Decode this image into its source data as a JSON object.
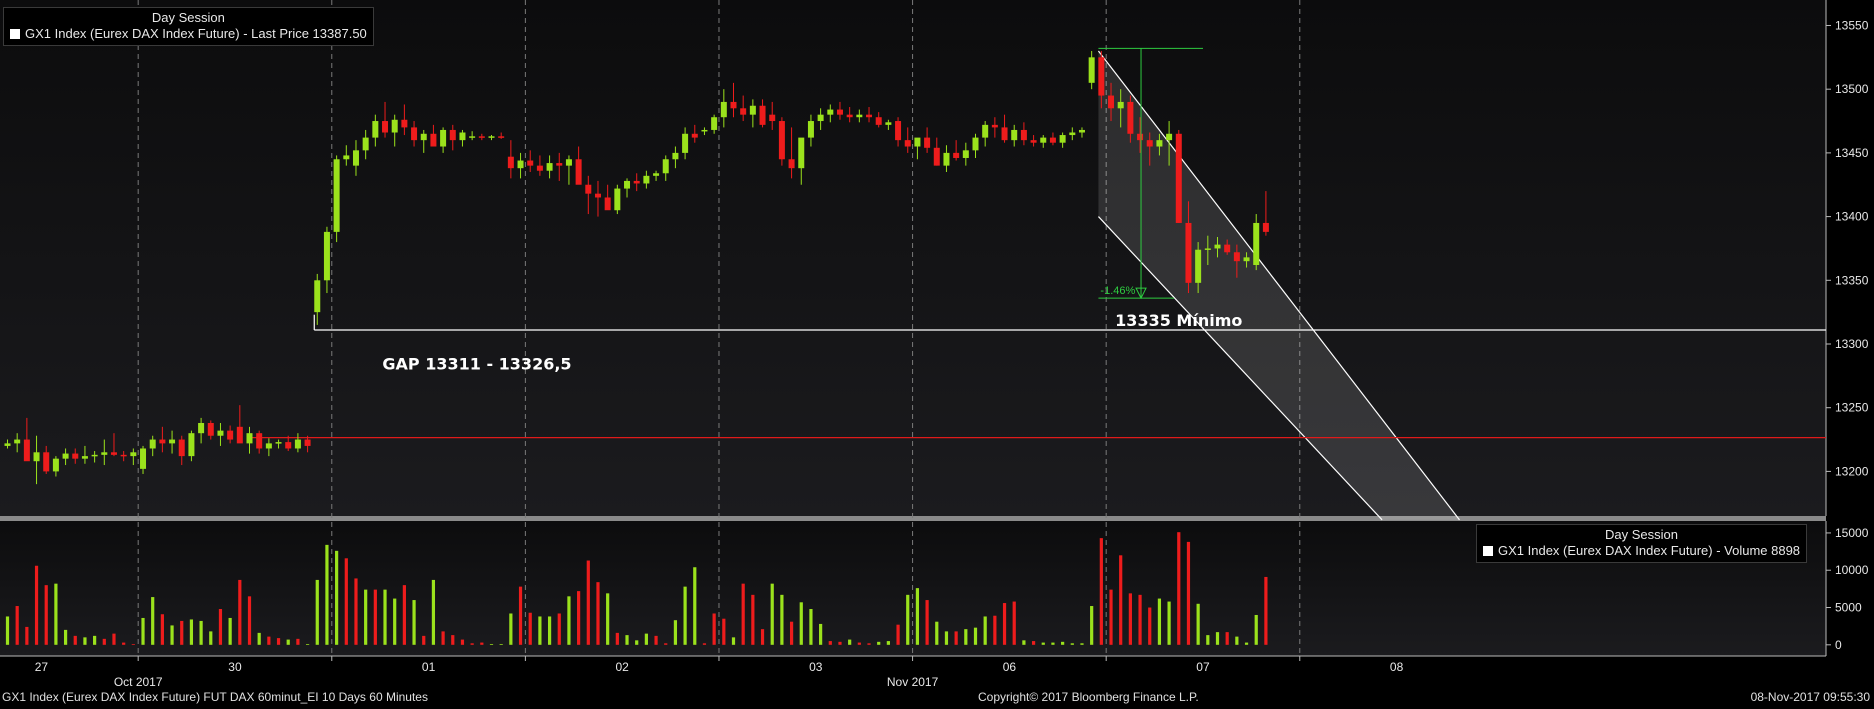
{
  "legend_price": {
    "session": "Day Session",
    "series": "GX1 Index (Eurex DAX Index Future) - Last Price 13387.50"
  },
  "legend_volume": {
    "session": "Day Session",
    "series": "GX1 Index (Eurex DAX Index Future) - Volume 8898"
  },
  "footer": {
    "left": "GX1 Index (Eurex DAX Index Future) FUT DAX 60minut_EI 10 Days 60 Minutes",
    "center": "Copyright© 2017 Bloomberg Finance L.P.",
    "right": "08-Nov-2017 09:55:30"
  },
  "colors": {
    "up": "#9be21c",
    "down": "#ee1c1c",
    "grid": "#7a7a7a",
    "line": "#ffffff"
  },
  "chart_data": {
    "type": "candlestick",
    "price_axis": {
      "ticks": [
        13200,
        13250,
        13300,
        13350,
        13400,
        13450,
        13500,
        13550
      ],
      "range": [
        13165,
        13570
      ]
    },
    "volume_axis": {
      "ticks": [
        0,
        5000,
        10000,
        15000
      ],
      "range": [
        -1500,
        16600
      ]
    },
    "x_tick_labels": [
      {
        "label": "27",
        "slot": 3.5
      },
      {
        "label": "30",
        "slot": 23.5
      },
      {
        "label": "01",
        "slot": 43.5
      },
      {
        "label": "02",
        "slot": 63.5
      },
      {
        "label": "03",
        "slot": 83.5
      },
      {
        "label": "06",
        "slot": 103.5
      },
      {
        "label": "07",
        "slot": 123.5
      },
      {
        "label": "08",
        "slot": 143.5
      }
    ],
    "month_labels": [
      {
        "label": "Oct 2017",
        "slot": 13.5
      },
      {
        "label": "Nov 2017",
        "slot": 93.5
      }
    ],
    "session_breaks": [
      13.5,
      33.5,
      53.5,
      73.5,
      93.5,
      113.5,
      133.5
    ],
    "candles": [
      [
        13220,
        13225,
        13218,
        13222
      ],
      [
        13222,
        13230,
        13215,
        13225
      ],
      [
        13225,
        13242,
        13210,
        13208
      ],
      [
        13208,
        13228,
        13190,
        13215
      ],
      [
        13215,
        13220,
        13198,
        13200
      ],
      [
        13200,
        13212,
        13196,
        13210
      ],
      [
        13210,
        13218,
        13205,
        13214
      ],
      [
        13214,
        13218,
        13206,
        13210
      ],
      [
        13210,
        13220,
        13206,
        13212
      ],
      [
        13212,
        13216,
        13207,
        13213
      ],
      [
        13213,
        13225,
        13205,
        13215
      ],
      [
        13215,
        13230,
        13212,
        13213
      ],
      [
        13213,
        13216,
        13208,
        13212
      ],
      [
        13212,
        13218,
        13205,
        13215
      ],
      [
        13202,
        13220,
        13198,
        13218
      ],
      [
        13218,
        13228,
        13212,
        13225
      ],
      [
        13225,
        13235,
        13215,
        13222
      ],
      [
        13222,
        13232,
        13214,
        13225
      ],
      [
        13225,
        13228,
        13205,
        13212
      ],
      [
        13212,
        13232,
        13208,
        13230
      ],
      [
        13230,
        13242,
        13222,
        13238
      ],
      [
        13238,
        13240,
        13225,
        13228
      ],
      [
        13228,
        13238,
        13220,
        13232
      ],
      [
        13232,
        13236,
        13222,
        13225
      ],
      [
        13235,
        13252,
        13225,
        13222
      ],
      [
        13222,
        13235,
        13214,
        13230
      ],
      [
        13230,
        13232,
        13214,
        13218
      ],
      [
        13218,
        13226,
        13212,
        13222
      ],
      [
        13222,
        13225,
        13218,
        13223
      ],
      [
        13223,
        13228,
        13216,
        13218
      ],
      [
        13218,
        13230,
        13215,
        13225
      ],
      [
        13225,
        13228,
        13215,
        13220
      ],
      [
        13325,
        13355,
        13315,
        13350
      ],
      [
        13350,
        13392,
        13340,
        13388
      ],
      [
        13388,
        13448,
        13380,
        13445
      ],
      [
        13445,
        13456,
        13440,
        13448
      ],
      [
        13440,
        13460,
        13432,
        13452
      ],
      [
        13452,
        13468,
        13445,
        13462
      ],
      [
        13462,
        13480,
        13455,
        13475
      ],
      [
        13475,
        13490,
        13462,
        13466
      ],
      [
        13466,
        13480,
        13455,
        13476
      ],
      [
        13476,
        13488,
        13464,
        13470
      ],
      [
        13470,
        13475,
        13455,
        13460
      ],
      [
        13460,
        13468,
        13450,
        13465
      ],
      [
        13465,
        13472,
        13456,
        13455
      ],
      [
        13455,
        13470,
        13450,
        13468
      ],
      [
        13468,
        13472,
        13452,
        13460
      ],
      [
        13460,
        13468,
        13455,
        13466
      ],
      [
        13463,
        13467,
        13460,
        13463
      ],
      [
        13463,
        13465,
        13460,
        13462
      ],
      [
        13462,
        13464,
        13460,
        13463
      ],
      [
        13463,
        13466,
        13461,
        13462
      ],
      [
        13447,
        13460,
        13430,
        13438
      ],
      [
        13438,
        13450,
        13430,
        13444
      ],
      [
        13444,
        13452,
        13435,
        13440
      ],
      [
        13440,
        13448,
        13432,
        13436
      ],
      [
        13436,
        13448,
        13430,
        13442
      ],
      [
        13442,
        13450,
        13428,
        13440
      ],
      [
        13440,
        13448,
        13425,
        13445
      ],
      [
        13445,
        13455,
        13430,
        13425
      ],
      [
        13425,
        13432,
        13402,
        13418
      ],
      [
        13418,
        13428,
        13400,
        13415
      ],
      [
        13415,
        13425,
        13410,
        13405
      ],
      [
        13405,
        13425,
        13402,
        13422
      ],
      [
        13422,
        13430,
        13415,
        13428
      ],
      [
        13428,
        13434,
        13420,
        13426
      ],
      [
        13426,
        13436,
        13422,
        13432
      ],
      [
        13432,
        13436,
        13428,
        13434
      ],
      [
        13434,
        13448,
        13428,
        13445
      ],
      [
        13445,
        13455,
        13438,
        13450
      ],
      [
        13450,
        13470,
        13445,
        13465
      ],
      [
        13465,
        13472,
        13458,
        13462
      ],
      [
        13467,
        13470,
        13464,
        13468
      ],
      [
        13468,
        13480,
        13465,
        13478
      ],
      [
        13478,
        13500,
        13470,
        13490
      ],
      [
        13490,
        13505,
        13478,
        13485
      ],
      [
        13485,
        13495,
        13475,
        13480
      ],
      [
        13480,
        13492,
        13470,
        13487
      ],
      [
        13487,
        13492,
        13470,
        13472
      ],
      [
        13480,
        13490,
        13468,
        13475
      ],
      [
        13475,
        13478,
        13440,
        13445
      ],
      [
        13445,
        13470,
        13430,
        13438
      ],
      [
        13438,
        13460,
        13425,
        13462
      ],
      [
        13462,
        13480,
        13455,
        13475
      ],
      [
        13475,
        13485,
        13468,
        13480
      ],
      [
        13480,
        13488,
        13474,
        13484
      ],
      [
        13484,
        13490,
        13476,
        13480
      ],
      [
        13480,
        13486,
        13474,
        13478
      ],
      [
        13478,
        13484,
        13474,
        13480
      ],
      [
        13480,
        13486,
        13474,
        13478
      ],
      [
        13478,
        13482,
        13470,
        13472
      ],
      [
        13472,
        13476,
        13468,
        13474
      ],
      [
        13475,
        13478,
        13455,
        13460
      ],
      [
        13460,
        13470,
        13450,
        13455
      ],
      [
        13455,
        13460,
        13445,
        13462
      ],
      [
        13462,
        13470,
        13450,
        13454
      ],
      [
        13454,
        13462,
        13440,
        13440
      ],
      [
        13440,
        13456,
        13435,
        13450
      ],
      [
        13450,
        13460,
        13444,
        13446
      ],
      [
        13446,
        13458,
        13440,
        13452
      ],
      [
        13452,
        13465,
        13446,
        13462
      ],
      [
        13462,
        13475,
        13455,
        13472
      ],
      [
        13472,
        13478,
        13462,
        13470
      ],
      [
        13470,
        13480,
        13458,
        13460
      ],
      [
        13460,
        13472,
        13455,
        13468
      ],
      [
        13468,
        13474,
        13456,
        13460
      ],
      [
        13460,
        13464,
        13455,
        13458
      ],
      [
        13458,
        13464,
        13454,
        13462
      ],
      [
        13462,
        13466,
        13456,
        13458
      ],
      [
        13458,
        13466,
        13454,
        13464
      ],
      [
        13464,
        13470,
        13460,
        13466
      ],
      [
        13466,
        13470,
        13462,
        13468
      ],
      [
        13505,
        13530,
        13500,
        13525
      ],
      [
        13525,
        13530,
        13485,
        13495
      ],
      [
        13495,
        13505,
        13475,
        13485
      ],
      [
        13485,
        13500,
        13470,
        13490
      ],
      [
        13490,
        13495,
        13458,
        13465
      ],
      [
        13465,
        13478,
        13450,
        13460
      ],
      [
        13460,
        13466,
        13440,
        13455
      ],
      [
        13455,
        13465,
        13448,
        13460
      ],
      [
        13460,
        13475,
        13440,
        13465
      ],
      [
        13465,
        13468,
        13395,
        13395
      ],
      [
        13395,
        13412,
        13340,
        13348
      ],
      [
        13348,
        13380,
        13340,
        13374
      ],
      [
        13374,
        13385,
        13362,
        13375
      ],
      [
        13375,
        13384,
        13368,
        13378
      ],
      [
        13378,
        13382,
        13370,
        13372
      ],
      [
        13372,
        13378,
        13352,
        13365
      ],
      [
        13365,
        13372,
        13360,
        13368
      ],
      [
        13362,
        13402,
        13358,
        13395
      ],
      [
        13395,
        13420,
        13385,
        13388
      ]
    ],
    "volumes": [
      [
        3800,
        "up"
      ],
      [
        5200,
        "down"
      ],
      [
        2400,
        "down"
      ],
      [
        10600,
        "down"
      ],
      [
        8000,
        "down"
      ],
      [
        8200,
        "up"
      ],
      [
        2000,
        "up"
      ],
      [
        1200,
        "down"
      ],
      [
        1000,
        "up"
      ],
      [
        1200,
        "up"
      ],
      [
        800,
        "down"
      ],
      [
        1500,
        "down"
      ],
      [
        300,
        "down"
      ],
      [
        100,
        "down"
      ],
      [
        3600,
        "up"
      ],
      [
        6400,
        "up"
      ],
      [
        4100,
        "down"
      ],
      [
        2600,
        "up"
      ],
      [
        3200,
        "down"
      ],
      [
        3400,
        "up"
      ],
      [
        3200,
        "up"
      ],
      [
        1800,
        "up"
      ],
      [
        4800,
        "down"
      ],
      [
        3600,
        "up"
      ],
      [
        8700,
        "down"
      ],
      [
        6500,
        "down"
      ],
      [
        1600,
        "up"
      ],
      [
        1100,
        "down"
      ],
      [
        900,
        "down"
      ],
      [
        700,
        "up"
      ],
      [
        800,
        "down"
      ],
      [
        100,
        "up"
      ],
      [
        8700,
        "up"
      ],
      [
        13400,
        "up"
      ],
      [
        12600,
        "up"
      ],
      [
        11600,
        "down"
      ],
      [
        8900,
        "down"
      ],
      [
        7400,
        "up"
      ],
      [
        7400,
        "down"
      ],
      [
        7400,
        "up"
      ],
      [
        6200,
        "up"
      ],
      [
        8000,
        "down"
      ],
      [
        6000,
        "up"
      ],
      [
        1200,
        "down"
      ],
      [
        8700,
        "up"
      ],
      [
        1800,
        "down"
      ],
      [
        1300,
        "down"
      ],
      [
        700,
        "down"
      ],
      [
        200,
        "down"
      ],
      [
        300,
        "down"
      ],
      [
        100,
        "up"
      ],
      [
        100,
        "up"
      ],
      [
        4200,
        "up"
      ],
      [
        7800,
        "down"
      ],
      [
        4300,
        "down"
      ],
      [
        3800,
        "up"
      ],
      [
        3800,
        "up"
      ],
      [
        4200,
        "down"
      ],
      [
        6500,
        "up"
      ],
      [
        7200,
        "down"
      ],
      [
        11300,
        "down"
      ],
      [
        8400,
        "down"
      ],
      [
        6900,
        "up"
      ],
      [
        1600,
        "down"
      ],
      [
        1300,
        "up"
      ],
      [
        600,
        "up"
      ],
      [
        1500,
        "up"
      ],
      [
        1200,
        "down"
      ],
      [
        200,
        "down"
      ],
      [
        3300,
        "up"
      ],
      [
        7800,
        "up"
      ],
      [
        10400,
        "up"
      ],
      [
        200,
        "down"
      ],
      [
        4200,
        "down"
      ],
      [
        3500,
        "down"
      ],
      [
        1000,
        "up"
      ],
      [
        8200,
        "down"
      ],
      [
        6700,
        "down"
      ],
      [
        2100,
        "down"
      ],
      [
        8200,
        "up"
      ],
      [
        6700,
        "up"
      ],
      [
        3100,
        "down"
      ],
      [
        5700,
        "up"
      ],
      [
        4800,
        "up"
      ],
      [
        2800,
        "up"
      ],
      [
        500,
        "down"
      ],
      [
        400,
        "down"
      ],
      [
        700,
        "up"
      ],
      [
        300,
        "down"
      ],
      [
        200,
        "down"
      ],
      [
        400,
        "up"
      ],
      [
        500,
        "up"
      ],
      [
        2700,
        "down"
      ],
      [
        6700,
        "up"
      ],
      [
        7600,
        "up"
      ],
      [
        6000,
        "down"
      ],
      [
        3100,
        "up"
      ],
      [
        1800,
        "up"
      ],
      [
        1800,
        "down"
      ],
      [
        2100,
        "up"
      ],
      [
        2300,
        "up"
      ],
      [
        3800,
        "up"
      ],
      [
        3900,
        "down"
      ],
      [
        5600,
        "down"
      ],
      [
        5800,
        "down"
      ],
      [
        600,
        "up"
      ],
      [
        500,
        "down"
      ],
      [
        300,
        "up"
      ],
      [
        300,
        "up"
      ],
      [
        400,
        "up"
      ],
      [
        200,
        "up"
      ],
      [
        200,
        "up"
      ],
      [
        5200,
        "up"
      ],
      [
        14300,
        "down"
      ],
      [
        7400,
        "down"
      ],
      [
        12000,
        "down"
      ],
      [
        6900,
        "down"
      ],
      [
        6700,
        "down"
      ],
      [
        5000,
        "down"
      ],
      [
        6200,
        "up"
      ],
      [
        5800,
        "up"
      ],
      [
        15100,
        "down"
      ],
      [
        13800,
        "down"
      ],
      [
        5500,
        "up"
      ],
      [
        1300,
        "up"
      ],
      [
        1700,
        "up"
      ],
      [
        1700,
        "down"
      ],
      [
        1100,
        "up"
      ],
      [
        300,
        "up"
      ],
      [
        4000,
        "up"
      ],
      [
        9100,
        "down"
      ]
    ],
    "overlays": {
      "gap_level": 13311,
      "prior_close_level": 13226.5,
      "channel_upper": {
        "from": [
          112.7,
          13530
        ],
        "to": [
          150,
          13162
        ]
      },
      "channel_lower": {
        "from": [
          112.7,
          13400
        ],
        "to": [
          142,
          13162
        ]
      },
      "measure_top": 13532,
      "measure_bottom": 13336,
      "measure_label": "-1.46%"
    },
    "annotations": [
      {
        "text": "GAP 13311 - 13326,5",
        "slot": 48.5,
        "price": 13280
      },
      {
        "text": "13335 Mínimo",
        "slot": 121,
        "price": 13314
      }
    ]
  }
}
